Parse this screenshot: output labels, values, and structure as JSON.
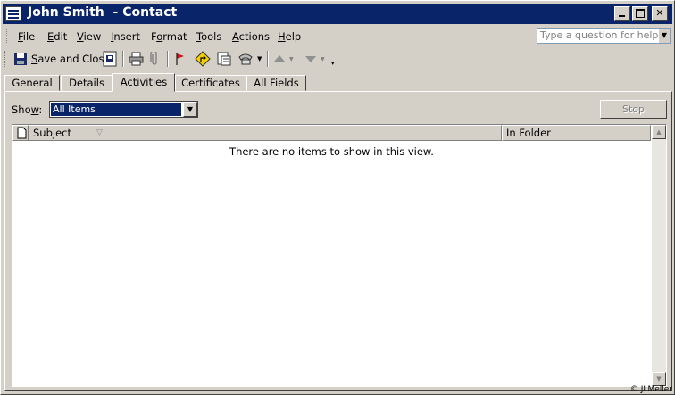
{
  "window": {
    "title": "John Smith  - Contact"
  },
  "menu": {
    "items": [
      {
        "pre": "",
        "u": "F",
        "post": "ile"
      },
      {
        "pre": "",
        "u": "E",
        "post": "dit"
      },
      {
        "pre": "",
        "u": "V",
        "post": "iew"
      },
      {
        "pre": "",
        "u": "I",
        "post": "nsert"
      },
      {
        "pre": "F",
        "u": "o",
        "post": "rmat"
      },
      {
        "pre": "",
        "u": "T",
        "post": "ools"
      },
      {
        "pre": "",
        "u": "A",
        "post": "ctions"
      },
      {
        "pre": "",
        "u": "H",
        "post": "elp"
      }
    ],
    "question_placeholder": "Type a question for help"
  },
  "toolbar": {
    "save_close_pre": "",
    "save_close_u": "S",
    "save_close_post": "ave and Close"
  },
  "tabs": [
    "General",
    "Details",
    "Activities",
    "Certificates",
    "All Fields"
  ],
  "active_tab": "Activities",
  "filter": {
    "label_pre": "Sho",
    "label_u": "w",
    "label_post": ":",
    "selected": "All Items"
  },
  "stop_label": "Stop",
  "columns": {
    "subject": "Subject",
    "in_folder": "In Folder"
  },
  "empty_message": "There are no items to show in this view.",
  "copyright": "© JLMeller"
}
